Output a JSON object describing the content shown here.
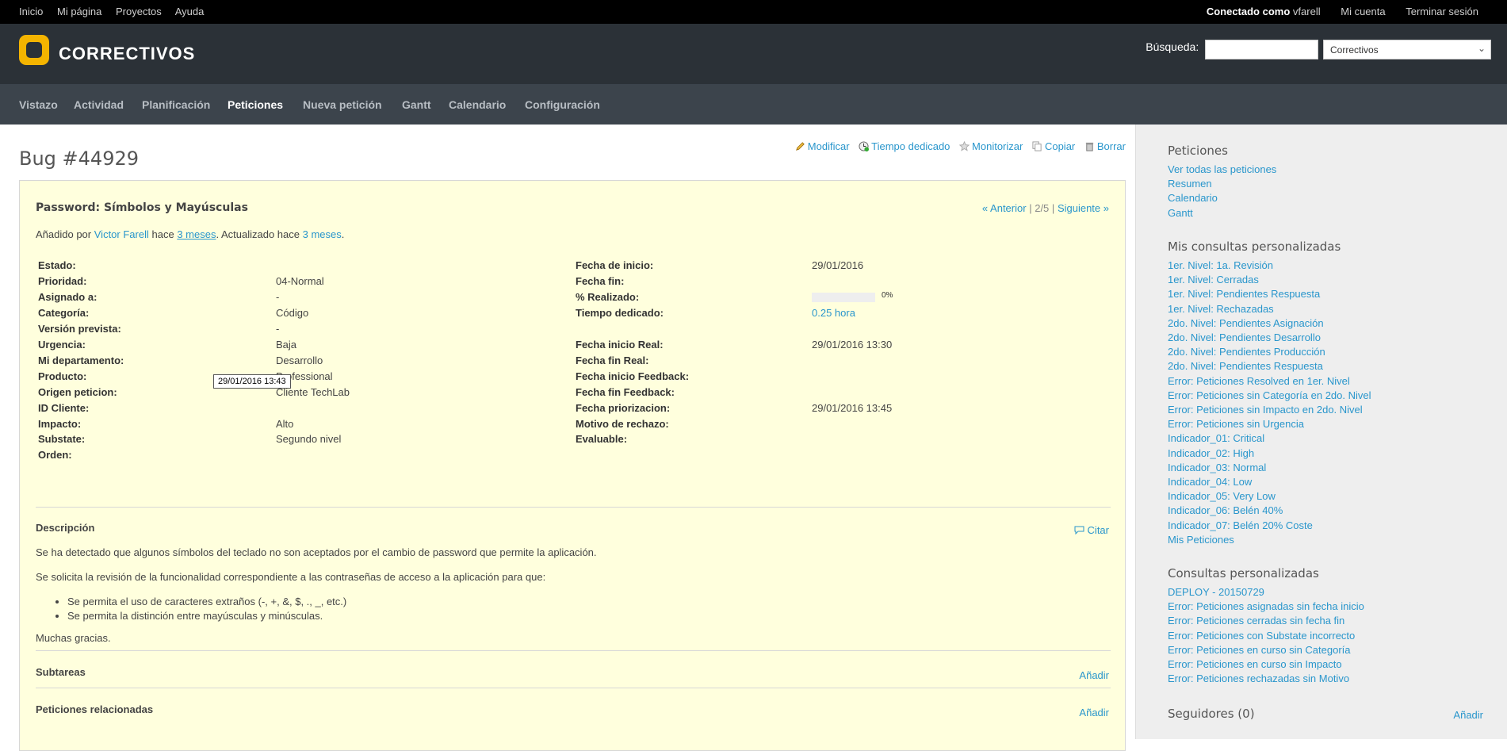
{
  "top_menu": {
    "left": [
      "Inicio",
      "Mi página",
      "Proyectos",
      "Ayuda"
    ],
    "logged_as_label": "Conectado como",
    "logged_user": "vfarell",
    "my_account": "Mi cuenta",
    "logout": "Terminar sesión"
  },
  "header": {
    "title": "CORRECTIVOS",
    "search_label": "Búsqueda:",
    "search_value": "",
    "project_select": "Correctivos"
  },
  "main_menu": [
    "Vistazo",
    "Actividad",
    "Planificación",
    "Peticiones",
    "Nueva petición",
    "Gantt",
    "Calendario",
    "Configuración"
  ],
  "main_menu_selected": "Peticiones",
  "issue": {
    "title": "Bug #44929",
    "actions": [
      "Modificar",
      "Tiempo dedicado",
      "Monitorizar",
      "Copiar",
      "Borrar"
    ],
    "subject": "Password: Símbolos y Mayúsculas",
    "prev": "« Anterior",
    "position": "2/5",
    "next": "Siguiente »",
    "added_by_prefix": "Añadido por",
    "author": "Victor Farell",
    "hace": "hace",
    "created_ago": "3 meses",
    "updated_prefix": ". Actualizado hace",
    "updated_ago": "3 meses",
    "tooltip": "29/01/2016 13:43",
    "left_attributes": [
      {
        "label": "Estado:",
        "value": ""
      },
      {
        "label": "Prioridad:",
        "value": "04-Normal"
      },
      {
        "label": "Asignado a:",
        "value": "-"
      },
      {
        "label": "Categoría:",
        "value": "Código"
      },
      {
        "label": "Versión prevista:",
        "value": "-"
      },
      {
        "label": "Urgencia:",
        "value": "Baja"
      },
      {
        "label": "Mi departamento:",
        "value": "Desarrollo"
      },
      {
        "label": "Producto:",
        "value": "Professional"
      },
      {
        "label": "Origen peticion:",
        "value": "Cliente TechLab"
      },
      {
        "label": "ID Cliente:",
        "value": ""
      },
      {
        "label": "Impacto:",
        "value": "Alto"
      },
      {
        "label": "Substate:",
        "value": "Segundo nivel"
      },
      {
        "label": "Orden:",
        "value": ""
      }
    ],
    "right_attributes": [
      {
        "label": "Fecha de inicio:",
        "value": "29/01/2016"
      },
      {
        "label": "Fecha fin:",
        "value": ""
      },
      {
        "label": "% Realizado:",
        "value": ""
      },
      {
        "label": "Tiempo dedicado:",
        "value": "0.25 hora"
      },
      {
        "label": "",
        "value": ""
      },
      {
        "label": "Fecha inicio Real:",
        "value": "29/01/2016 13:30"
      },
      {
        "label": "Fecha fin Real:",
        "value": ""
      },
      {
        "label": "Fecha inicio Feedback:",
        "value": ""
      },
      {
        "label": "Fecha fin Feedback:",
        "value": ""
      },
      {
        "label": "Fecha priorizacion:",
        "value": "29/01/2016 13:45"
      },
      {
        "label": "Motivo de rechazo:",
        "value": ""
      },
      {
        "label": "Evaluable:",
        "value": ""
      }
    ],
    "done_ratio": 0,
    "done_ratio_text": "0%",
    "description_title": "Descripción",
    "quote": "Citar",
    "description_p1": "Se ha detectado que algunos símbolos del teclado no son aceptados por el cambio de password que permite la aplicación.",
    "description_p2": "Se solicita la revisión de la funcionalidad correspondiente a las contraseñas de acceso a la aplicación para que:",
    "description_items": [
      "Se permita el uso de caracteres extraños (-, +, &, $, ., _, etc.)",
      "Se permita la distinción entre mayúsculas y minúsculas."
    ],
    "description_p3": "Muchas gracias.",
    "subtasks_title": "Subtareas",
    "related_title": "Peticiones relacionadas",
    "add_label": "Añadir"
  },
  "sidebar": {
    "issues_title": "Peticiones",
    "issues_links": [
      "Ver todas las peticiones",
      "Resumen",
      "Calendario",
      "Gantt"
    ],
    "my_queries_title": "Mis consultas personalizadas",
    "my_queries": [
      "1er. Nivel: 1a. Revisión",
      "1er. Nivel: Cerradas",
      "1er. Nivel: Pendientes Respuesta",
      "1er. Nivel: Rechazadas",
      "2do. Nivel: Pendientes Asignación",
      "2do. Nivel: Pendientes Desarrollo",
      "2do. Nivel: Pendientes Producción",
      "2do. Nivel: Pendientes Respuesta",
      "Error: Peticiones Resolved en 1er. Nivel",
      "Error: Peticiones sin Categoría en 2do. Nivel",
      "Error: Peticiones sin Impacto en 2do. Nivel",
      "Error: Peticiones sin Urgencia",
      "Indicador_01: Critical",
      "Indicador_02: High",
      "Indicador_03: Normal",
      "Indicador_04: Low",
      "Indicador_05: Very Low",
      "Indicador_06: Belén 40%",
      "Indicador_07: Belén 20% Coste",
      "Mis Peticiones"
    ],
    "queries_title": "Consultas personalizadas",
    "queries": [
      "DEPLOY - 20150729",
      "Error: Peticiones asignadas sin fecha inicio",
      "Error: Peticiones cerradas sin fecha fin",
      "Error: Peticiones con Substate incorrecto",
      "Error: Peticiones en curso sin Categoría",
      "Error: Peticiones en curso sin Impacto",
      "Error: Peticiones rechazadas sin Motivo"
    ],
    "followers_title": "Seguidores (0)",
    "followers_add": "Añadir"
  }
}
